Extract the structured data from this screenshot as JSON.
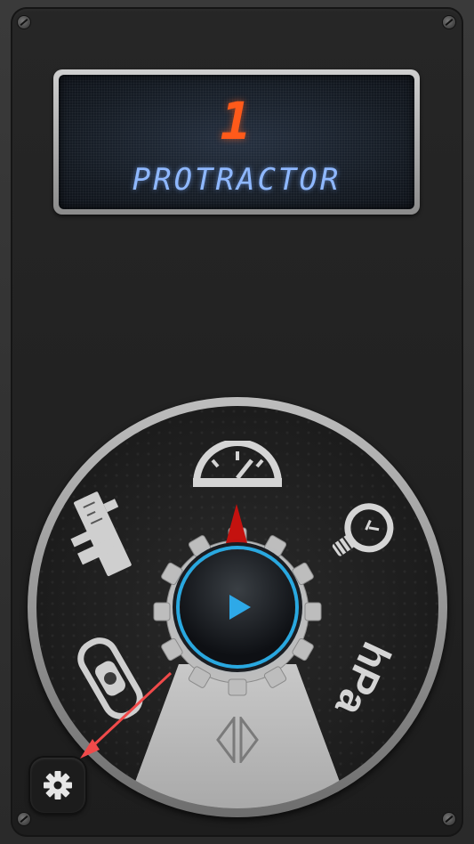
{
  "display": {
    "value": "1",
    "mode_label": "PROTRACTOR"
  },
  "dial": {
    "tools": [
      {
        "icon": "speedometer-icon"
      },
      {
        "icon": "lightbulb-icon"
      },
      {
        "icon": "hpa-barometer",
        "label": "hPa"
      },
      {
        "icon": "level-icon"
      },
      {
        "icon": "caliper-ruler-icon"
      }
    ],
    "selector_icon": "left-right-arrows-icon",
    "center_button_icon": "play-icon"
  },
  "settings": {
    "icon": "gear-icon"
  },
  "colors": {
    "lcd_number": "#ff5a1a",
    "lcd_label": "#8fb8ff",
    "accent_ring": "#29a8e0",
    "needle": "#c4120f",
    "annotation_arrow": "#f04a4a"
  }
}
